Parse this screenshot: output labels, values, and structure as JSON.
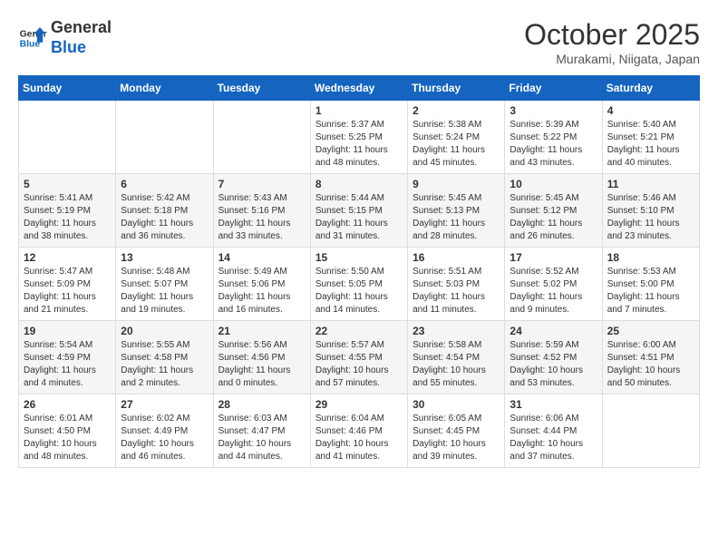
{
  "logo": {
    "line1": "General",
    "line2": "Blue"
  },
  "title": "October 2025",
  "subtitle": "Murakami, Niigata, Japan",
  "days_of_week": [
    "Sunday",
    "Monday",
    "Tuesday",
    "Wednesday",
    "Thursday",
    "Friday",
    "Saturday"
  ],
  "weeks": [
    [
      {
        "day": "",
        "info": ""
      },
      {
        "day": "",
        "info": ""
      },
      {
        "day": "",
        "info": ""
      },
      {
        "day": "1",
        "info": "Sunrise: 5:37 AM\nSunset: 5:25 PM\nDaylight: 11 hours\nand 48 minutes."
      },
      {
        "day": "2",
        "info": "Sunrise: 5:38 AM\nSunset: 5:24 PM\nDaylight: 11 hours\nand 45 minutes."
      },
      {
        "day": "3",
        "info": "Sunrise: 5:39 AM\nSunset: 5:22 PM\nDaylight: 11 hours\nand 43 minutes."
      },
      {
        "day": "4",
        "info": "Sunrise: 5:40 AM\nSunset: 5:21 PM\nDaylight: 11 hours\nand 40 minutes."
      }
    ],
    [
      {
        "day": "5",
        "info": "Sunrise: 5:41 AM\nSunset: 5:19 PM\nDaylight: 11 hours\nand 38 minutes."
      },
      {
        "day": "6",
        "info": "Sunrise: 5:42 AM\nSunset: 5:18 PM\nDaylight: 11 hours\nand 36 minutes."
      },
      {
        "day": "7",
        "info": "Sunrise: 5:43 AM\nSunset: 5:16 PM\nDaylight: 11 hours\nand 33 minutes."
      },
      {
        "day": "8",
        "info": "Sunrise: 5:44 AM\nSunset: 5:15 PM\nDaylight: 11 hours\nand 31 minutes."
      },
      {
        "day": "9",
        "info": "Sunrise: 5:45 AM\nSunset: 5:13 PM\nDaylight: 11 hours\nand 28 minutes."
      },
      {
        "day": "10",
        "info": "Sunrise: 5:45 AM\nSunset: 5:12 PM\nDaylight: 11 hours\nand 26 minutes."
      },
      {
        "day": "11",
        "info": "Sunrise: 5:46 AM\nSunset: 5:10 PM\nDaylight: 11 hours\nand 23 minutes."
      }
    ],
    [
      {
        "day": "12",
        "info": "Sunrise: 5:47 AM\nSunset: 5:09 PM\nDaylight: 11 hours\nand 21 minutes."
      },
      {
        "day": "13",
        "info": "Sunrise: 5:48 AM\nSunset: 5:07 PM\nDaylight: 11 hours\nand 19 minutes."
      },
      {
        "day": "14",
        "info": "Sunrise: 5:49 AM\nSunset: 5:06 PM\nDaylight: 11 hours\nand 16 minutes."
      },
      {
        "day": "15",
        "info": "Sunrise: 5:50 AM\nSunset: 5:05 PM\nDaylight: 11 hours\nand 14 minutes."
      },
      {
        "day": "16",
        "info": "Sunrise: 5:51 AM\nSunset: 5:03 PM\nDaylight: 11 hours\nand 11 minutes."
      },
      {
        "day": "17",
        "info": "Sunrise: 5:52 AM\nSunset: 5:02 PM\nDaylight: 11 hours\nand 9 minutes."
      },
      {
        "day": "18",
        "info": "Sunrise: 5:53 AM\nSunset: 5:00 PM\nDaylight: 11 hours\nand 7 minutes."
      }
    ],
    [
      {
        "day": "19",
        "info": "Sunrise: 5:54 AM\nSunset: 4:59 PM\nDaylight: 11 hours\nand 4 minutes."
      },
      {
        "day": "20",
        "info": "Sunrise: 5:55 AM\nSunset: 4:58 PM\nDaylight: 11 hours\nand 2 minutes."
      },
      {
        "day": "21",
        "info": "Sunrise: 5:56 AM\nSunset: 4:56 PM\nDaylight: 11 hours\nand 0 minutes."
      },
      {
        "day": "22",
        "info": "Sunrise: 5:57 AM\nSunset: 4:55 PM\nDaylight: 10 hours\nand 57 minutes."
      },
      {
        "day": "23",
        "info": "Sunrise: 5:58 AM\nSunset: 4:54 PM\nDaylight: 10 hours\nand 55 minutes."
      },
      {
        "day": "24",
        "info": "Sunrise: 5:59 AM\nSunset: 4:52 PM\nDaylight: 10 hours\nand 53 minutes."
      },
      {
        "day": "25",
        "info": "Sunrise: 6:00 AM\nSunset: 4:51 PM\nDaylight: 10 hours\nand 50 minutes."
      }
    ],
    [
      {
        "day": "26",
        "info": "Sunrise: 6:01 AM\nSunset: 4:50 PM\nDaylight: 10 hours\nand 48 minutes."
      },
      {
        "day": "27",
        "info": "Sunrise: 6:02 AM\nSunset: 4:49 PM\nDaylight: 10 hours\nand 46 minutes."
      },
      {
        "day": "28",
        "info": "Sunrise: 6:03 AM\nSunset: 4:47 PM\nDaylight: 10 hours\nand 44 minutes."
      },
      {
        "day": "29",
        "info": "Sunrise: 6:04 AM\nSunset: 4:46 PM\nDaylight: 10 hours\nand 41 minutes."
      },
      {
        "day": "30",
        "info": "Sunrise: 6:05 AM\nSunset: 4:45 PM\nDaylight: 10 hours\nand 39 minutes."
      },
      {
        "day": "31",
        "info": "Sunrise: 6:06 AM\nSunset: 4:44 PM\nDaylight: 10 hours\nand 37 minutes."
      },
      {
        "day": "",
        "info": ""
      }
    ]
  ]
}
